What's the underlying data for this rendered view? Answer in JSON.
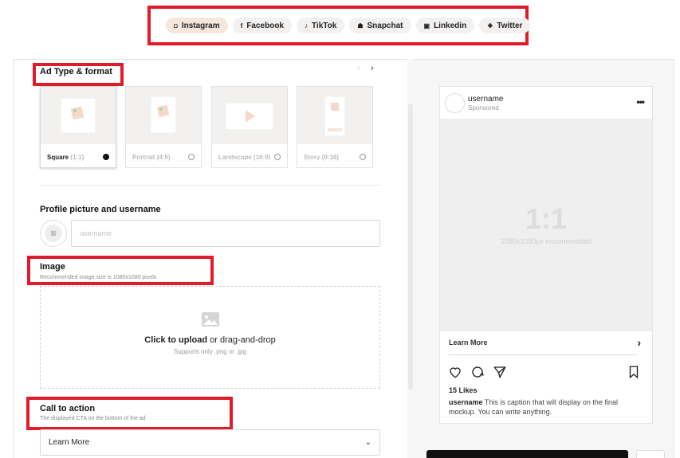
{
  "platform_tabs": [
    {
      "label": "Instagram",
      "icon": "instagram-icon",
      "glyph": "◘",
      "active": true
    },
    {
      "label": "Facebook",
      "icon": "facebook-icon",
      "glyph": "f",
      "active": false
    },
    {
      "label": "TikTok",
      "icon": "tiktok-icon",
      "glyph": "♪",
      "active": false
    },
    {
      "label": "Snapchat",
      "icon": "snapchat-icon",
      "glyph": "☗",
      "active": false
    },
    {
      "label": "Linkedin",
      "icon": "linkedin-icon",
      "glyph": "▣",
      "active": false
    },
    {
      "label": "Twitter",
      "icon": "twitter-icon",
      "glyph": "❖",
      "active": false
    }
  ],
  "ad_type": {
    "title": "Ad Type & format",
    "formats": [
      {
        "name": "Square",
        "ratio": "(1:1)",
        "selected": true
      },
      {
        "name": "Portrait",
        "ratio": "(4:5)",
        "selected": false
      },
      {
        "name": "Landscape",
        "ratio": "(16:9)",
        "selected": false
      },
      {
        "name": "Story",
        "ratio": "(9:16)",
        "selected": false
      }
    ]
  },
  "profile": {
    "title": "Profile picture and username",
    "username_placeholder": "username",
    "username_value": ""
  },
  "image": {
    "title": "Image",
    "subtitle": "Recommended image size is 1080x1080 pixels",
    "upload_bold": "Click to upload",
    "upload_rest": " or drag-and-drop",
    "upload_sub": "Supports only .png or .jpg"
  },
  "cta": {
    "title": "Call to action",
    "subtitle": "The displayed CTA on the bottom of the ad",
    "selected": "Learn More"
  },
  "preview": {
    "username": "username",
    "sponsored": "Sponsored",
    "ratio": "1:1",
    "size_hint": "1080x1080px recommended",
    "cta_label": "Learn More",
    "likes": "15 Likes",
    "caption_user": "username",
    "caption_text": " This is caption that will display on the final mockup. You can write anything."
  },
  "colors": {
    "highlight": "#e01b2a",
    "active_tab": "#f6e7dc"
  }
}
